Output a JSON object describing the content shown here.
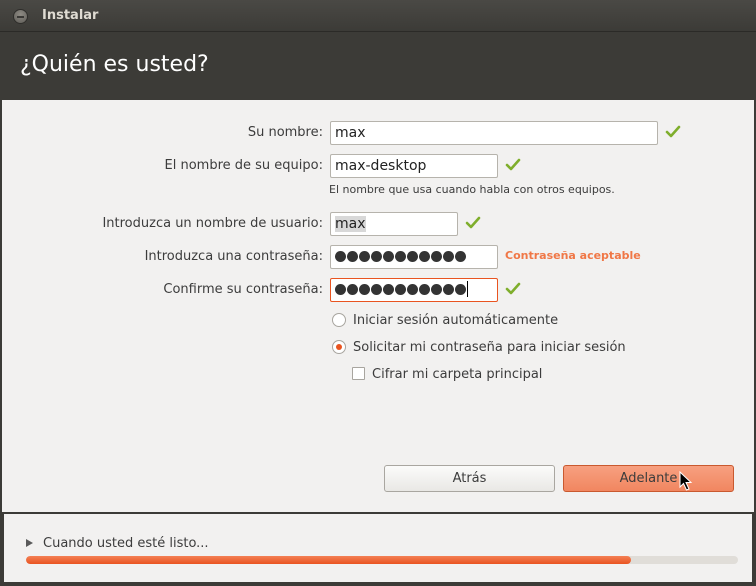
{
  "window": {
    "title": "Instalar"
  },
  "page": {
    "heading": "¿Quién es usted?"
  },
  "form": {
    "name": {
      "label": "Su nombre:",
      "value": "max"
    },
    "computer": {
      "label": "El nombre de su equipo:",
      "value": "max-desktop",
      "hint": "El nombre que usa cuando habla con otros equipos."
    },
    "username": {
      "label": "Introduzca un nombre de usuario:",
      "value": "max"
    },
    "password": {
      "label": "Introduzca una contraseña:",
      "strength": "Contraseña aceptable",
      "mask_length": 11
    },
    "confirm": {
      "label": "Confirme su contraseña:",
      "mask_length": 11
    },
    "login_auto": {
      "label": "Iniciar sesión automáticamente",
      "selected": false
    },
    "login_password": {
      "label": "Solicitar mi contraseña para iniciar sesión",
      "selected": true
    },
    "encrypt_home": {
      "label": "Cifrar mi carpeta principal",
      "checked": false
    }
  },
  "buttons": {
    "back": "Atrás",
    "next": "Adelante"
  },
  "footer": {
    "ready_text": "Cuando usted esté listo...",
    "progress": 0.85
  },
  "colors": {
    "accent": "#e95420",
    "check": "#7fae2c",
    "strength": "#f07746"
  }
}
